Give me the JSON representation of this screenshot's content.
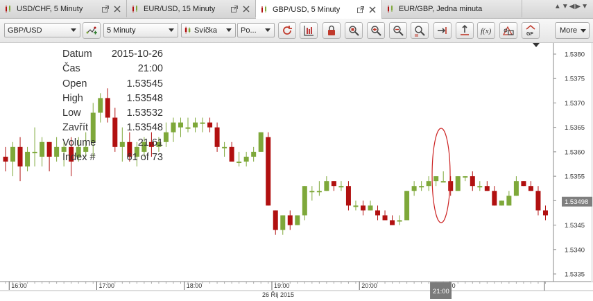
{
  "tabs": [
    {
      "label": "USD/CHF, 5 Minuty",
      "active": false
    },
    {
      "label": "EUR/USD, 15 Minuty",
      "active": false
    },
    {
      "label": "GBP/USD, 5 Minuty",
      "active": true
    },
    {
      "label": "EUR/GBP, Jedna minuta",
      "active": false
    }
  ],
  "toolbar": {
    "instrument": "GBP/USD",
    "period": "5 Minuty",
    "chart_type": "Svíčka",
    "price_type": "Po...",
    "more_label": "More",
    "buttons": [
      "refresh-icon",
      "bar-chart-icon",
      "lock-icon",
      "zoom-area-icon",
      "zoom-in-icon",
      "zoom-out-icon",
      "zoom-fit-icon",
      "shift-icon",
      "vertical-scale-icon",
      "fx-icon",
      "indicator-icon",
      "gf-icon"
    ]
  },
  "info": {
    "rows": [
      {
        "label": "Datum",
        "value": "2015-10-26"
      },
      {
        "label": "Čas",
        "value": "21:00"
      },
      {
        "label": "Open",
        "value": "1.53545"
      },
      {
        "label": "High",
        "value": "1.53548"
      },
      {
        "label": "Low",
        "value": "1.53532"
      },
      {
        "label": "Zavřít",
        "value": "1.53548"
      },
      {
        "label": "Volume",
        "value": "21.61"
      },
      {
        "label": "Index #",
        "value": "61 of 73"
      }
    ]
  },
  "colors": {
    "up": "#7ea83a",
    "down": "#b11010",
    "annotation": "#cc2222",
    "price_marker": "#7f7f7f"
  },
  "chart_data": {
    "type": "candlestick",
    "instrument": "GBP/USD",
    "ylim": [
      1.5332,
      1.5383
    ],
    "yticks": [
      "1.5380",
      "1.5375",
      "1.5370",
      "1.5365",
      "1.5360",
      "1.5355",
      "1.5350",
      "1.5345",
      "1.5340",
      "1.5335"
    ],
    "xticks": [
      {
        "label": "16:00",
        "index": 0.5
      },
      {
        "label": "17:00",
        "index": 12.5
      },
      {
        "label": "18:00",
        "index": 24.5
      },
      {
        "label": "19:00",
        "index": 36.5
      },
      {
        "label": "20:00",
        "index": 48.5
      },
      {
        "label": "0",
        "index": 60.9
      }
    ],
    "date_label": "26 Říj 2015",
    "crosshair_time": "21:00",
    "crosshair_index": 59.7,
    "current_price": "1.53498",
    "current_value": 1.53498,
    "highlight_index": 59.7,
    "candles": [
      {
        "o": 1.5359,
        "h": 1.5361,
        "l": 1.5356,
        "c": 1.5358
      },
      {
        "o": 1.5358,
        "h": 1.5362,
        "l": 1.5355,
        "c": 1.5361
      },
      {
        "o": 1.5361,
        "h": 1.5363,
        "l": 1.5354,
        "c": 1.5357
      },
      {
        "o": 1.5357,
        "h": 1.5361,
        "l": 1.5356,
        "c": 1.536
      },
      {
        "o": 1.536,
        "h": 1.5365,
        "l": 1.5357,
        "c": 1.536
      },
      {
        "o": 1.5359,
        "h": 1.5363,
        "l": 1.5357,
        "c": 1.5362
      },
      {
        "o": 1.5362,
        "h": 1.5362,
        "l": 1.5356,
        "c": 1.5359
      },
      {
        "o": 1.5359,
        "h": 1.5363,
        "l": 1.5358,
        "c": 1.5361
      },
      {
        "o": 1.536,
        "h": 1.5362,
        "l": 1.5357,
        "c": 1.5361
      },
      {
        "o": 1.5361,
        "h": 1.5363,
        "l": 1.5355,
        "c": 1.5358
      },
      {
        "o": 1.5359,
        "h": 1.5363,
        "l": 1.5358,
        "c": 1.5361
      },
      {
        "o": 1.536,
        "h": 1.5364,
        "l": 1.5359,
        "c": 1.5361
      },
      {
        "o": 1.5362,
        "h": 1.537,
        "l": 1.5359,
        "c": 1.5368
      },
      {
        "o": 1.5368,
        "h": 1.5372,
        "l": 1.5366,
        "c": 1.5371
      },
      {
        "o": 1.5371,
        "h": 1.5373,
        "l": 1.5366,
        "c": 1.5367
      },
      {
        "o": 1.5367,
        "h": 1.5369,
        "l": 1.536,
        "c": 1.5361
      },
      {
        "o": 1.5361,
        "h": 1.5365,
        "l": 1.5358,
        "c": 1.5362
      },
      {
        "o": 1.5362,
        "h": 1.5364,
        "l": 1.5358,
        "c": 1.5359
      },
      {
        "o": 1.5359,
        "h": 1.5362,
        "l": 1.5357,
        "c": 1.5361
      },
      {
        "o": 1.536,
        "h": 1.5363,
        "l": 1.5359,
        "c": 1.5362
      },
      {
        "o": 1.5362,
        "h": 1.5364,
        "l": 1.5359,
        "c": 1.5361
      },
      {
        "o": 1.5361,
        "h": 1.5363,
        "l": 1.536,
        "c": 1.5362
      },
      {
        "o": 1.5362,
        "h": 1.5366,
        "l": 1.5361,
        "c": 1.5364
      },
      {
        "o": 1.5364,
        "h": 1.5367,
        "l": 1.5362,
        "c": 1.5366
      },
      {
        "o": 1.5365,
        "h": 1.5367,
        "l": 1.5363,
        "c": 1.5366
      },
      {
        "o": 1.5365,
        "h": 1.5367,
        "l": 1.5364,
        "c": 1.5365
      },
      {
        "o": 1.5365,
        "h": 1.5367,
        "l": 1.5364,
        "c": 1.5366
      },
      {
        "o": 1.5366,
        "h": 1.5367,
        "l": 1.5364,
        "c": 1.5366
      },
      {
        "o": 1.5366,
        "h": 1.5367,
        "l": 1.5364,
        "c": 1.5365
      },
      {
        "o": 1.5365,
        "h": 1.5366,
        "l": 1.536,
        "c": 1.5361
      },
      {
        "o": 1.5361,
        "h": 1.5362,
        "l": 1.5359,
        "c": 1.5361
      },
      {
        "o": 1.5361,
        "h": 1.5362,
        "l": 1.5358,
        "c": 1.5358
      },
      {
        "o": 1.5358,
        "h": 1.536,
        "l": 1.5357,
        "c": 1.5358
      },
      {
        "o": 1.5358,
        "h": 1.536,
        "l": 1.5357,
        "c": 1.5359
      },
      {
        "o": 1.5359,
        "h": 1.5361,
        "l": 1.5358,
        "c": 1.536
      },
      {
        "o": 1.536,
        "h": 1.5364,
        "l": 1.536,
        "c": 1.5364
      },
      {
        "o": 1.5363,
        "h": 1.5364,
        "l": 1.5349,
        "c": 1.5349
      },
      {
        "o": 1.5348,
        "h": 1.5348,
        "l": 1.5343,
        "c": 1.5344
      },
      {
        "o": 1.5344,
        "h": 1.5347,
        "l": 1.5343,
        "c": 1.5347
      },
      {
        "o": 1.5347,
        "h": 1.5348,
        "l": 1.5344,
        "c": 1.5345
      },
      {
        "o": 1.5345,
        "h": 1.5347,
        "l": 1.5345,
        "c": 1.5347
      },
      {
        "o": 1.5347,
        "h": 1.5353,
        "l": 1.5346,
        "c": 1.5353
      },
      {
        "o": 1.5352,
        "h": 1.5353,
        "l": 1.535,
        "c": 1.5352
      },
      {
        "o": 1.5352,
        "h": 1.5354,
        "l": 1.5351,
        "c": 1.5352
      },
      {
        "o": 1.5352,
        "h": 1.5355,
        "l": 1.5352,
        "c": 1.5354
      },
      {
        "o": 1.5354,
        "h": 1.5354,
        "l": 1.5352,
        "c": 1.5353
      },
      {
        "o": 1.5353,
        "h": 1.5354,
        "l": 1.5352,
        "c": 1.5353
      },
      {
        "o": 1.5353,
        "h": 1.5354,
        "l": 1.5348,
        "c": 1.5349
      },
      {
        "o": 1.5349,
        "h": 1.535,
        "l": 1.5348,
        "c": 1.5349
      },
      {
        "o": 1.5349,
        "h": 1.535,
        "l": 1.5347,
        "c": 1.5348
      },
      {
        "o": 1.5348,
        "h": 1.535,
        "l": 1.5348,
        "c": 1.5349
      },
      {
        "o": 1.5348,
        "h": 1.5349,
        "l": 1.5346,
        "c": 1.5347
      },
      {
        "o": 1.5347,
        "h": 1.5348,
        "l": 1.5346,
        "c": 1.5346
      },
      {
        "o": 1.5346,
        "h": 1.5347,
        "l": 1.5345,
        "c": 1.5345
      },
      {
        "o": 1.5346,
        "h": 1.5347,
        "l": 1.5345,
        "c": 1.5346
      },
      {
        "o": 1.5346,
        "h": 1.5352,
        "l": 1.5346,
        "c": 1.5352
      },
      {
        "o": 1.5352,
        "h": 1.5354,
        "l": 1.5351,
        "c": 1.5353
      },
      {
        "o": 1.5353,
        "h": 1.5354,
        "l": 1.5352,
        "c": 1.5353
      },
      {
        "o": 1.5353,
        "h": 1.5355,
        "l": 1.5352,
        "c": 1.5354
      },
      {
        "o": 1.5354,
        "h": 1.5355,
        "l": 1.5353,
        "c": 1.5355
      },
      {
        "o": 1.5354,
        "h": 1.5356,
        "l": 1.5354,
        "c": 1.5354
      },
      {
        "o": 1.5354,
        "h": 1.5355,
        "l": 1.5351,
        "c": 1.5352
      },
      {
        "o": 1.5352,
        "h": 1.5355,
        "l": 1.5352,
        "c": 1.5355
      },
      {
        "o": 1.5355,
        "h": 1.5355,
        "l": 1.5354,
        "c": 1.5355
      },
      {
        "o": 1.5355,
        "h": 1.5356,
        "l": 1.5352,
        "c": 1.5353
      },
      {
        "o": 1.5353,
        "h": 1.5354,
        "l": 1.5352,
        "c": 1.5353
      },
      {
        "o": 1.5353,
        "h": 1.5354,
        "l": 1.5352,
        "c": 1.5352
      },
      {
        "o": 1.5352,
        "h": 1.5353,
        "l": 1.5349,
        "c": 1.5349
      },
      {
        "o": 1.5349,
        "h": 1.535,
        "l": 1.5349,
        "c": 1.535
      },
      {
        "o": 1.5349,
        "h": 1.5352,
        "l": 1.5349,
        "c": 1.5351
      },
      {
        "o": 1.5351,
        "h": 1.5355,
        "l": 1.5351,
        "c": 1.5354
      },
      {
        "o": 1.5354,
        "h": 1.5354,
        "l": 1.5353,
        "c": 1.5353
      },
      {
        "o": 1.5353,
        "h": 1.5354,
        "l": 1.5352,
        "c": 1.5352
      },
      {
        "o": 1.5352,
        "h": 1.5353,
        "l": 1.5347,
        "c": 1.5348
      },
      {
        "o": 1.5348,
        "h": 1.5349,
        "l": 1.5346,
        "c": 1.5347
      }
    ]
  }
}
